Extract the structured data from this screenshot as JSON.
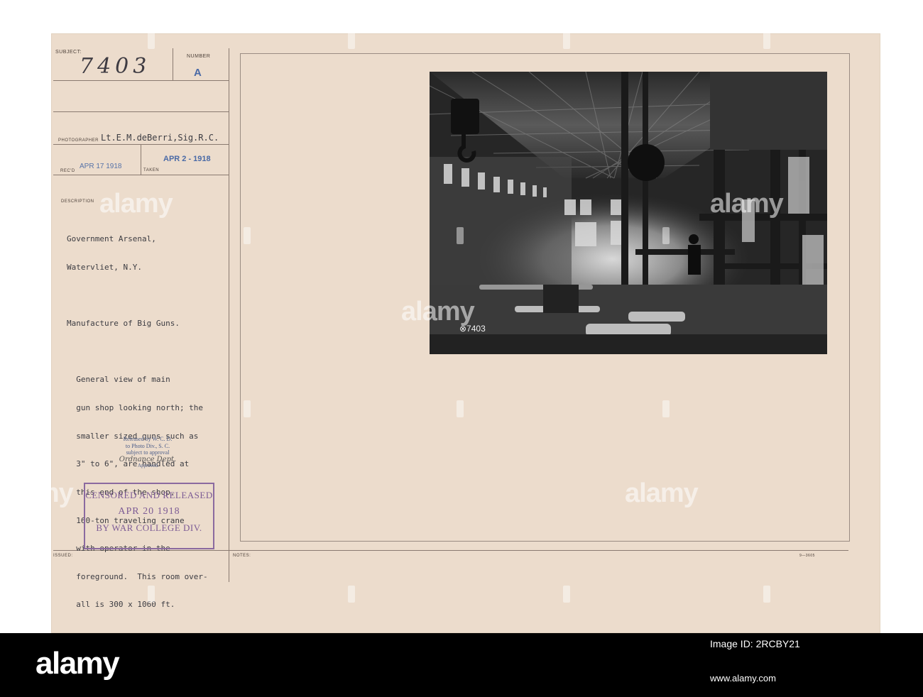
{
  "card": {
    "subject_label": "SUBJECT:",
    "subject_number": "7403",
    "number_label": "NUMBER",
    "number_value": "A",
    "photographer_label": "PHOTOGRAPHER",
    "photographer_value": "Lt.E.M.deBerri,Sig.R.C.",
    "recd_label": "REC'D",
    "recd_date": "APR 17 1918",
    "taken_label": "TAKEN",
    "taken_date": "APR 2 - 1918",
    "description_label": "DESCRIPTION",
    "description_lines": [
      "Government Arsenal,",
      "Watervliet, N.Y.",
      "",
      "Manufacture of Big Guns.",
      "",
      "  General view of main",
      "  gun shop looking north; the",
      "  smaller sized guns such as",
      "  3\" to 6\", are handled at",
      "  this end of the shop.",
      "  160-ton traveling crane",
      "  with operator in the",
      "  foreground.  This room over-",
      "  all is 300 x 1060 ft."
    ],
    "release_lines": [
      "Released by W. C. D.",
      "to Photo Div., S. C.",
      "subject to approval"
    ],
    "release_signature": "Ordnance Dept.",
    "release_approved": "Approved",
    "censor_line1": "CENSORED AND RELEASED",
    "censor_line2": "APR 20 1918",
    "censor_line3": "BY WAR COLLEGE DIV.",
    "issued_label": "ISSUED:",
    "notes_label": "NOTES:",
    "form_number": "9—3605",
    "photo_mark": "⊗7403"
  },
  "watermark": {
    "text": "alamy"
  },
  "banner": {
    "logo": "alamy",
    "image_id": "Image ID: 2RCBY21",
    "url": "www.alamy.com"
  },
  "colors": {
    "card_bg": "#ecdccc",
    "stamp_blue": "#4a6aa6",
    "stamp_purple": "#7c5b95",
    "banner_bg": "#000000"
  }
}
